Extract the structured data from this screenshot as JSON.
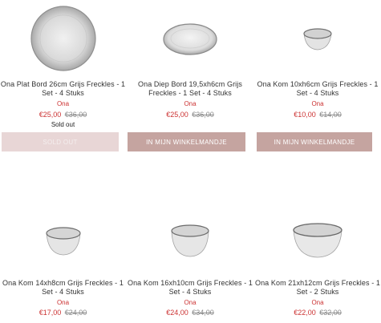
{
  "products": [
    {
      "title": "Ona Plat Bord 26cm Grijs Freckles - 1 Set - 4 Stuks",
      "brand": "Ona",
      "price_now": "€25,00",
      "price_was": "€36,00",
      "stock": "Sold out",
      "button": "SOLD OUT",
      "image_icon": "flat-plate-icon"
    },
    {
      "title": "Ona Diep Bord 19,5xh6cm Grijs Freckles - 1 Set - 4 Stuks",
      "brand": "Ona",
      "price_now": "€25,00",
      "price_was": "€36,00",
      "button": "IN MIJN WINKELMANDJE",
      "image_icon": "deep-plate-icon"
    },
    {
      "title": "Ona Kom 10xh6cm Grijs Freckles - 1 Set - 4 Stuks",
      "brand": "Ona",
      "price_now": "€10,00",
      "price_was": "€14,00",
      "button": "IN MIJN WINKELMANDJE",
      "image_icon": "small-bowl-icon"
    },
    {
      "title": "Ona Kom 14xh8cm Grijs Freckles - 1 Set - 4 Stuks",
      "brand": "Ona",
      "price_now": "€17,00",
      "price_was": "€24,00",
      "image_icon": "bowl-icon"
    },
    {
      "title": "Ona Kom 16xh10cm Grijs Freckles - 1 Set - 4 Stuks",
      "brand": "Ona",
      "price_now": "€24,00",
      "price_was": "€34,00",
      "image_icon": "deep-bowl-icon"
    },
    {
      "title": "Ona Kom 21xh12cm Grijs Freckles - 1 Set - 2 Stuks",
      "brand": "Ona",
      "price_now": "€22,00",
      "price_was": "€32,00",
      "image_icon": "large-bowl-icon"
    }
  ],
  "colors": {
    "price": "#cc3333",
    "button_add": "#c5a4a0",
    "button_sold": "#e8d6d6"
  }
}
